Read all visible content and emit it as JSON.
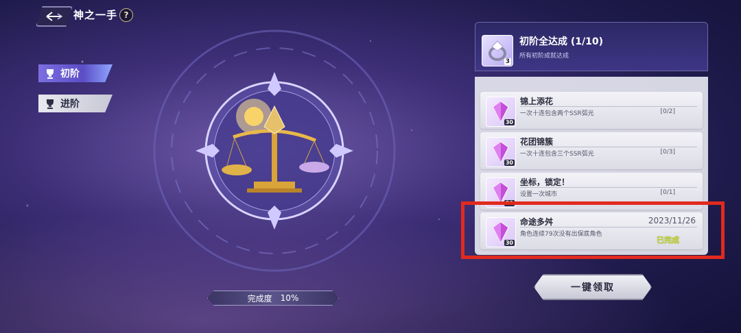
{
  "header": {
    "title": "神之一手",
    "help_label": "?"
  },
  "tabs": [
    {
      "label": "初阶",
      "active": true
    },
    {
      "label": "进阶",
      "active": false
    }
  ],
  "progress": {
    "label": "完成度",
    "value": "10%"
  },
  "achievement_group": {
    "title": "初阶全达成 (1/10)",
    "subtitle": "所有初阶成就达成",
    "reward_count": "3"
  },
  "achievements": [
    {
      "name": "锦上添花",
      "desc": "一次十连包含两个SSR弧光",
      "progress": "[0/2]",
      "reward_count": "30"
    },
    {
      "name": "花团锦簇",
      "desc": "一次十连包含三个SSR弧光",
      "progress": "[0/3]",
      "reward_count": "30"
    },
    {
      "name": "坐标，锁定！",
      "desc": "设置一次城市",
      "progress": "[0/1]",
      "reward_count": "30"
    },
    {
      "name": "命途多舛",
      "desc": "角色连续79次没有出保底角色",
      "date": "2023/11/26",
      "status": "已完成",
      "reward_count": "30"
    }
  ],
  "claim_button": {
    "label": "一键领取"
  },
  "colors": {
    "highlight": "#e12a1e",
    "done_text": "#c7d93a",
    "accent_tab": "#7c6fe0"
  }
}
